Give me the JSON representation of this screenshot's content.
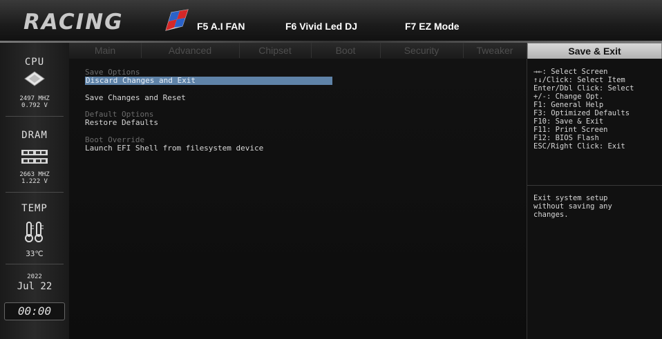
{
  "header": {
    "logo": "RACING",
    "f5": "F5 A.I FAN",
    "f6": "F6 Vivid Led DJ",
    "f7": "F7 EZ Mode"
  },
  "sidebar": {
    "cpu": {
      "label": "CPU",
      "freq": "2497 MHZ",
      "volt": "0.792 V"
    },
    "dram": {
      "label": "DRAM",
      "freq": "2663 MHZ",
      "volt": "1.222 V"
    },
    "temp": {
      "label": "TEMP",
      "value": "33℃"
    },
    "date": {
      "year": "2022",
      "day": "Jul 22"
    },
    "clock": "00:00"
  },
  "tabs": [
    "Main",
    "Advanced",
    "Chipset",
    "Boot",
    "Security",
    "Tweaker",
    "Save & Exit"
  ],
  "menu": {
    "save_options": "Save Options",
    "discard_exit": "Discard Changes and Exit",
    "save_reset": "Save Changes and Reset",
    "default_options": "Default Options",
    "restore_defaults": "Restore Defaults",
    "boot_override": "Boot Override",
    "launch_efi": "Launch EFI Shell from filesystem device"
  },
  "help": {
    "keys": [
      "→←: Select Screen",
      "↑↓/Click: Select Item",
      "Enter/Dbl Click: Select",
      "+/-: Change Opt.",
      "F1: General Help",
      "F3: Optimized Defaults",
      "F10: Save & Exit",
      "F11: Print Screen",
      "F12: BIOS Flash",
      "ESC/Right Click: Exit"
    ],
    "description": [
      "Exit system setup",
      "without saving any",
      "changes."
    ]
  },
  "colors": {
    "selection": "#5f83a8",
    "active_tab": "#c8c8c8",
    "logo_red": "#d62828",
    "logo_blue": "#2a62c9"
  }
}
